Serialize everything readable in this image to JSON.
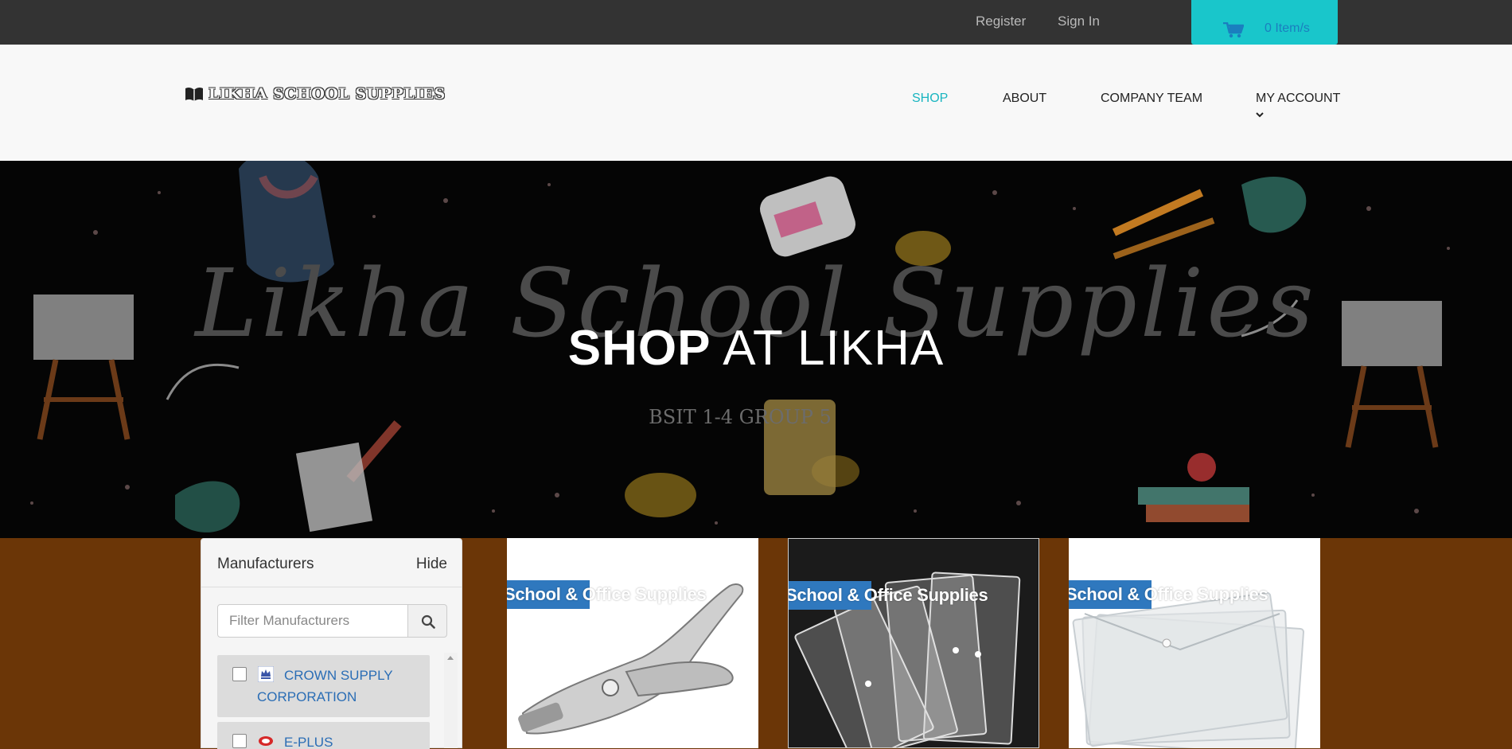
{
  "topbar": {
    "register": "Register",
    "sign_in": "Sign In",
    "cart_label": "0 Item/s"
  },
  "header": {
    "logo_text": "LIKHA SCHOOL SUPPLIES",
    "nav": [
      {
        "label": "SHOP",
        "active": true
      },
      {
        "label": "ABOUT"
      },
      {
        "label": "COMPANY TEAM"
      },
      {
        "label": "MY ACCOUNT",
        "has_dropdown": true
      }
    ]
  },
  "hero": {
    "script_text": "Likha School Supplies",
    "title_bold": "SHOP",
    "title_rest": "AT LIKHA",
    "subtitle": "BSIT 1-4 GROUP 5"
  },
  "manufacturers": {
    "title": "Manufacturers",
    "hide_label": "Hide",
    "filter_placeholder": "Filter Manufacturers",
    "items": [
      {
        "name": "CROWN SUPPLY CORPORATION"
      },
      {
        "name": "E-PLUS STATIONERY,"
      }
    ]
  },
  "products": [
    {
      "category": "School & Office Supplies",
      "image": "hole-puncher"
    },
    {
      "category": "School & Office Supplies",
      "image": "clear-envelopes-dark"
    },
    {
      "category": "School & Office Supplies",
      "image": "clear-envelopes-white"
    }
  ],
  "colors": {
    "topbar": "#333333",
    "cart": "#19c6cb",
    "nav_active": "#19b5c0",
    "page_bg": "#6b3607",
    "ribbon": "#2f78be",
    "link": "#2a6db5"
  }
}
